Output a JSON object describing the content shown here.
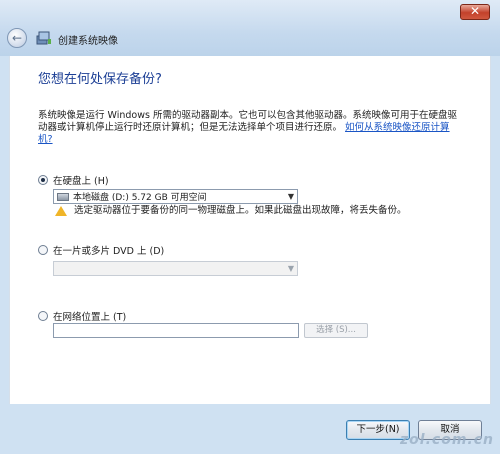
{
  "window": {
    "title": "创建系统映像",
    "close_label": "✕"
  },
  "content": {
    "heading": "您想在何处保存备份?",
    "description": "系统映像是运行 Windows 所需的驱动器副本。它也可以包含其他驱动器。系统映像可用于在硬盘驱动器或计算机停止运行时还原计算机；但是无法选择单个项目进行还原。",
    "description_link": "如何从系统映像还原计算机?",
    "option_hdd": {
      "label": "在硬盘上 (H)",
      "selected": true,
      "dropdown_value": "本地磁盘 (D:)  5.72 GB 可用空间",
      "warning": "选定驱动器位于要备份的同一物理磁盘上。如果此磁盘出现故障，将丢失备份。"
    },
    "option_dvd": {
      "label": "在一片或多片 DVD 上 (D)",
      "selected": false,
      "dropdown_value": ""
    },
    "option_network": {
      "label": "在网络位置上 (T)",
      "selected": false,
      "input_value": "",
      "browse_label": "选择 (S)..."
    }
  },
  "buttons": {
    "next": "下一步(N)",
    "cancel": "取消"
  },
  "watermark": "zol.com.cn"
}
